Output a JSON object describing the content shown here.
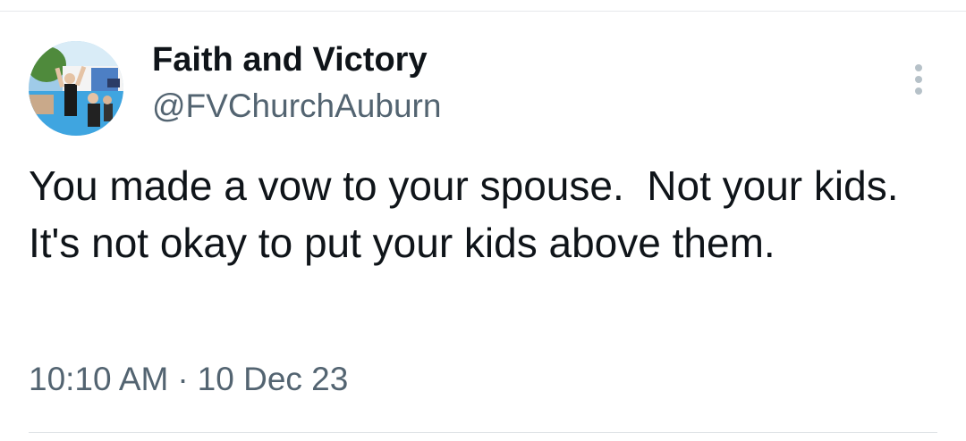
{
  "author": {
    "display_name": "Faith and Victory",
    "handle": "@FVChurchAuburn"
  },
  "tweet": {
    "text": "You made a vow to your spouse.  Not your kids.  It's not okay to put your kids above them.",
    "time": "10:10 AM",
    "separator": "·",
    "date": "10 Dec 23"
  },
  "icons": {
    "more": "more-vertical-icon",
    "avatar": "avatar-photo"
  },
  "colors": {
    "text_primary": "#0f1419",
    "text_secondary": "#536471",
    "divider": "#e6e9eb",
    "more_icon": "#b6c1c8"
  }
}
